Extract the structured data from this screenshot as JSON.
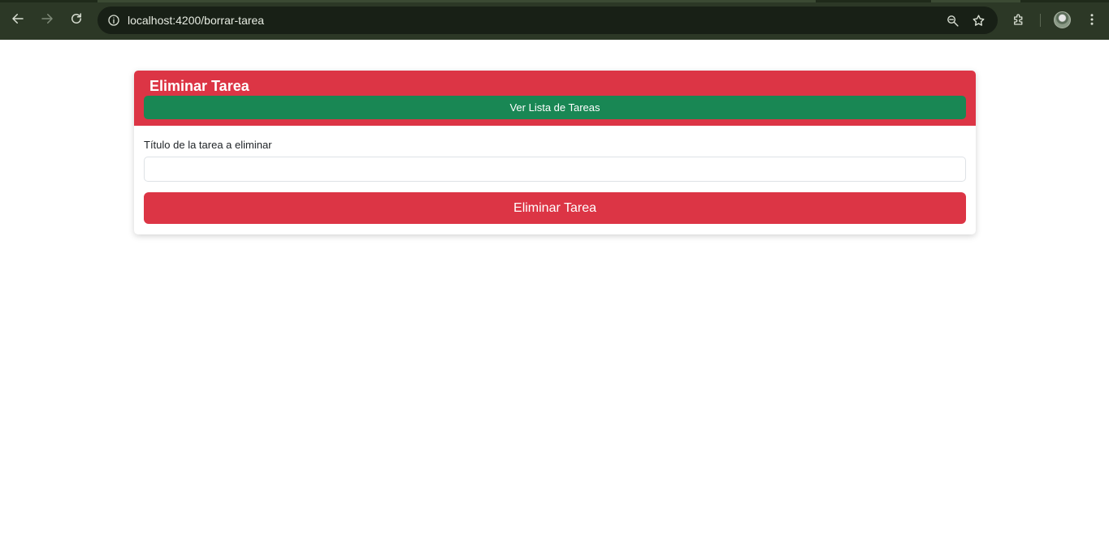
{
  "browser": {
    "url": "localhost:4200/borrar-tarea",
    "icons": {
      "back": "back-arrow-icon",
      "forward": "forward-arrow-icon",
      "reload": "reload-icon",
      "site_info": "info-icon",
      "zoom": "zoom-icon",
      "bookmark": "star-icon",
      "extensions": "puzzle-icon",
      "profile": "avatar",
      "menu": "kebab-menu-icon"
    }
  },
  "card": {
    "title": "Eliminar Tarea",
    "list_button_label": "Ver Lista de Tareas",
    "field_label": "Título de la tarea a eliminar",
    "field_value": "",
    "delete_button_label": "Eliminar Tarea"
  },
  "colors": {
    "danger": "#dc3545",
    "success": "#198754",
    "chrome": "#2c3826"
  }
}
